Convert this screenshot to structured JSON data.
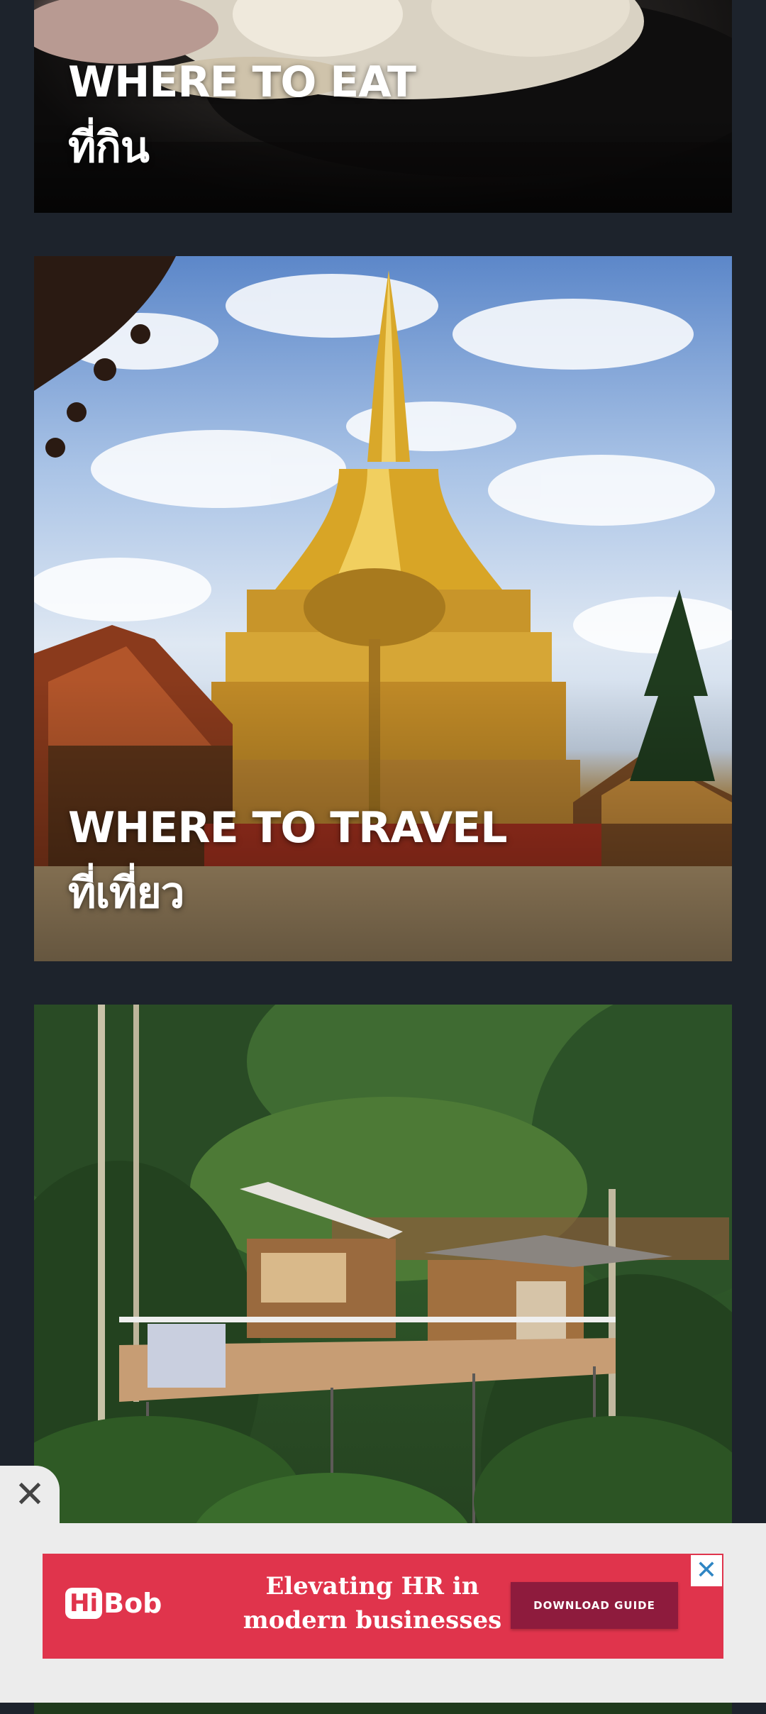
{
  "cards": [
    {
      "title_en": "WHERE TO EAT",
      "title_th": "ที่กิน",
      "image": "food-photo"
    },
    {
      "title_en": "WHERE TO TRAVEL",
      "title_th": "ที่เที่ยว",
      "image": "golden-temple-photo"
    },
    {
      "image": "treehouse-forest-photo"
    }
  ],
  "ad": {
    "dismiss_icon": "close-icon",
    "close_icon": "close-icon",
    "logo_hi": "Hi",
    "logo_bob": "Bob",
    "headline_line1": "Elevating HR in",
    "headline_line2": "modern businesses",
    "cta_label": "DOWNLOAD GUIDE",
    "dismiss_glyph": "✕",
    "close_glyph": "✕"
  },
  "colors": {
    "background": "#1d232c",
    "ad_banner": "#e0344c",
    "ad_cta": "#8e1b3d",
    "ad_area": "#ececec"
  }
}
